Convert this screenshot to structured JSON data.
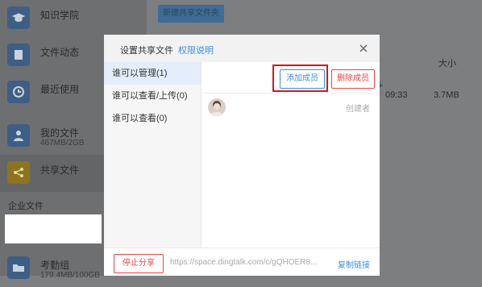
{
  "sidebar": {
    "items": [
      {
        "label": "知识学院",
        "sub": "",
        "icon": "graduation-cap-icon"
      },
      {
        "label": "文件动态",
        "sub": "",
        "icon": "file-icon"
      },
      {
        "label": "最近使用",
        "sub": "",
        "icon": "clock-icon"
      },
      {
        "label": "我的文件",
        "sub": "467MB/2GB",
        "icon": "user-icon"
      },
      {
        "label": "共享文件",
        "sub": "",
        "icon": "share-icon"
      },
      {
        "label": "考勤组",
        "sub": "179.4MB/100GB",
        "icon": "folder-icon"
      }
    ],
    "group_label": "企业文件"
  },
  "main": {
    "new_folder_label": "新建共享文件夹",
    "size_header": "大小",
    "row_time": "09:33",
    "row_size": "3.7MB"
  },
  "modal": {
    "title": "设置共享文件",
    "help_link": "权限说明",
    "permissions": [
      {
        "label": "谁可以管理(1)"
      },
      {
        "label": "谁可以查看/上传(0)"
      },
      {
        "label": "谁可以查看(0)"
      }
    ],
    "add_member_label": "添加成员",
    "remove_member_label": "删除成员",
    "creator_label": "创建者",
    "stop_share_label": "停止分享",
    "share_url": "https://space.dingtalk.com/c/gQHOER8...",
    "copy_link_label": "复制链接"
  },
  "colors": {
    "accent": "#3a8ee6",
    "danger": "#e84545",
    "highlight": "#d9151b"
  }
}
